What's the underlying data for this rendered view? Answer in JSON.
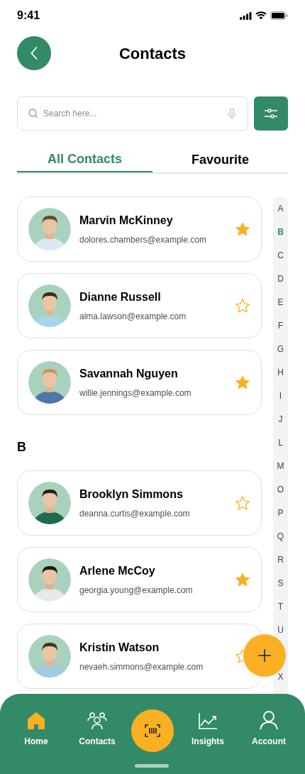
{
  "status_bar": {
    "time": "9:41"
  },
  "header": {
    "title": "Contacts"
  },
  "search": {
    "placeholder": "Search here..."
  },
  "tabs": [
    {
      "label": "All Contacts",
      "selected": true
    },
    {
      "label": "Favourite",
      "selected": false
    }
  ],
  "sections": [
    {
      "contacts": [
        {
          "name": "Marvin McKinney",
          "email": "dolores.chambers@example.com",
          "favourite": true
        },
        {
          "name": "Dianne Russell",
          "email": "alma.lawson@example.com",
          "favourite": false
        },
        {
          "name": "Savannah Nguyen",
          "email": "willie.jennings@example.com",
          "favourite": true
        }
      ]
    },
    {
      "header": "B",
      "contacts": [
        {
          "name": "Brooklyn Simmons",
          "email": "deanna.curtis@example.com",
          "favourite": false
        },
        {
          "name": "Arlene McCoy",
          "email": "georgia.young@example.com",
          "favourite": true
        },
        {
          "name": "Kristin Watson",
          "email": "nevaeh.simmons@example.com",
          "favourite": false
        }
      ]
    }
  ],
  "index": [
    {
      "letter": "A",
      "selected": false
    },
    {
      "letter": "B",
      "selected": true
    },
    {
      "letter": "C",
      "selected": false
    },
    {
      "letter": "D",
      "selected": false
    },
    {
      "letter": "E",
      "selected": false
    },
    {
      "letter": "F",
      "selected": false
    },
    {
      "letter": "G",
      "selected": false
    },
    {
      "letter": "H",
      "selected": false
    },
    {
      "letter": "I",
      "selected": false
    },
    {
      "letter": "J",
      "selected": false
    },
    {
      "letter": "L",
      "selected": false
    },
    {
      "letter": "M",
      "selected": false
    },
    {
      "letter": "O",
      "selected": false
    },
    {
      "letter": "P",
      "selected": false
    },
    {
      "letter": "Q",
      "selected": false
    },
    {
      "letter": "R",
      "selected": false
    },
    {
      "letter": "S",
      "selected": false
    },
    {
      "letter": "T",
      "selected": false
    },
    {
      "letter": "U",
      "selected": false
    },
    {
      "letter": "X",
      "selected": false
    }
  ],
  "bottom_nav": [
    {
      "kind": "tab",
      "label": "Home",
      "selected": true
    },
    {
      "kind": "tab",
      "label": "Contacts",
      "selected": false
    },
    {
      "kind": "scan"
    },
    {
      "kind": "tab",
      "label": "Insights",
      "selected": false
    },
    {
      "kind": "tab",
      "label": "Account",
      "selected": false
    }
  ]
}
